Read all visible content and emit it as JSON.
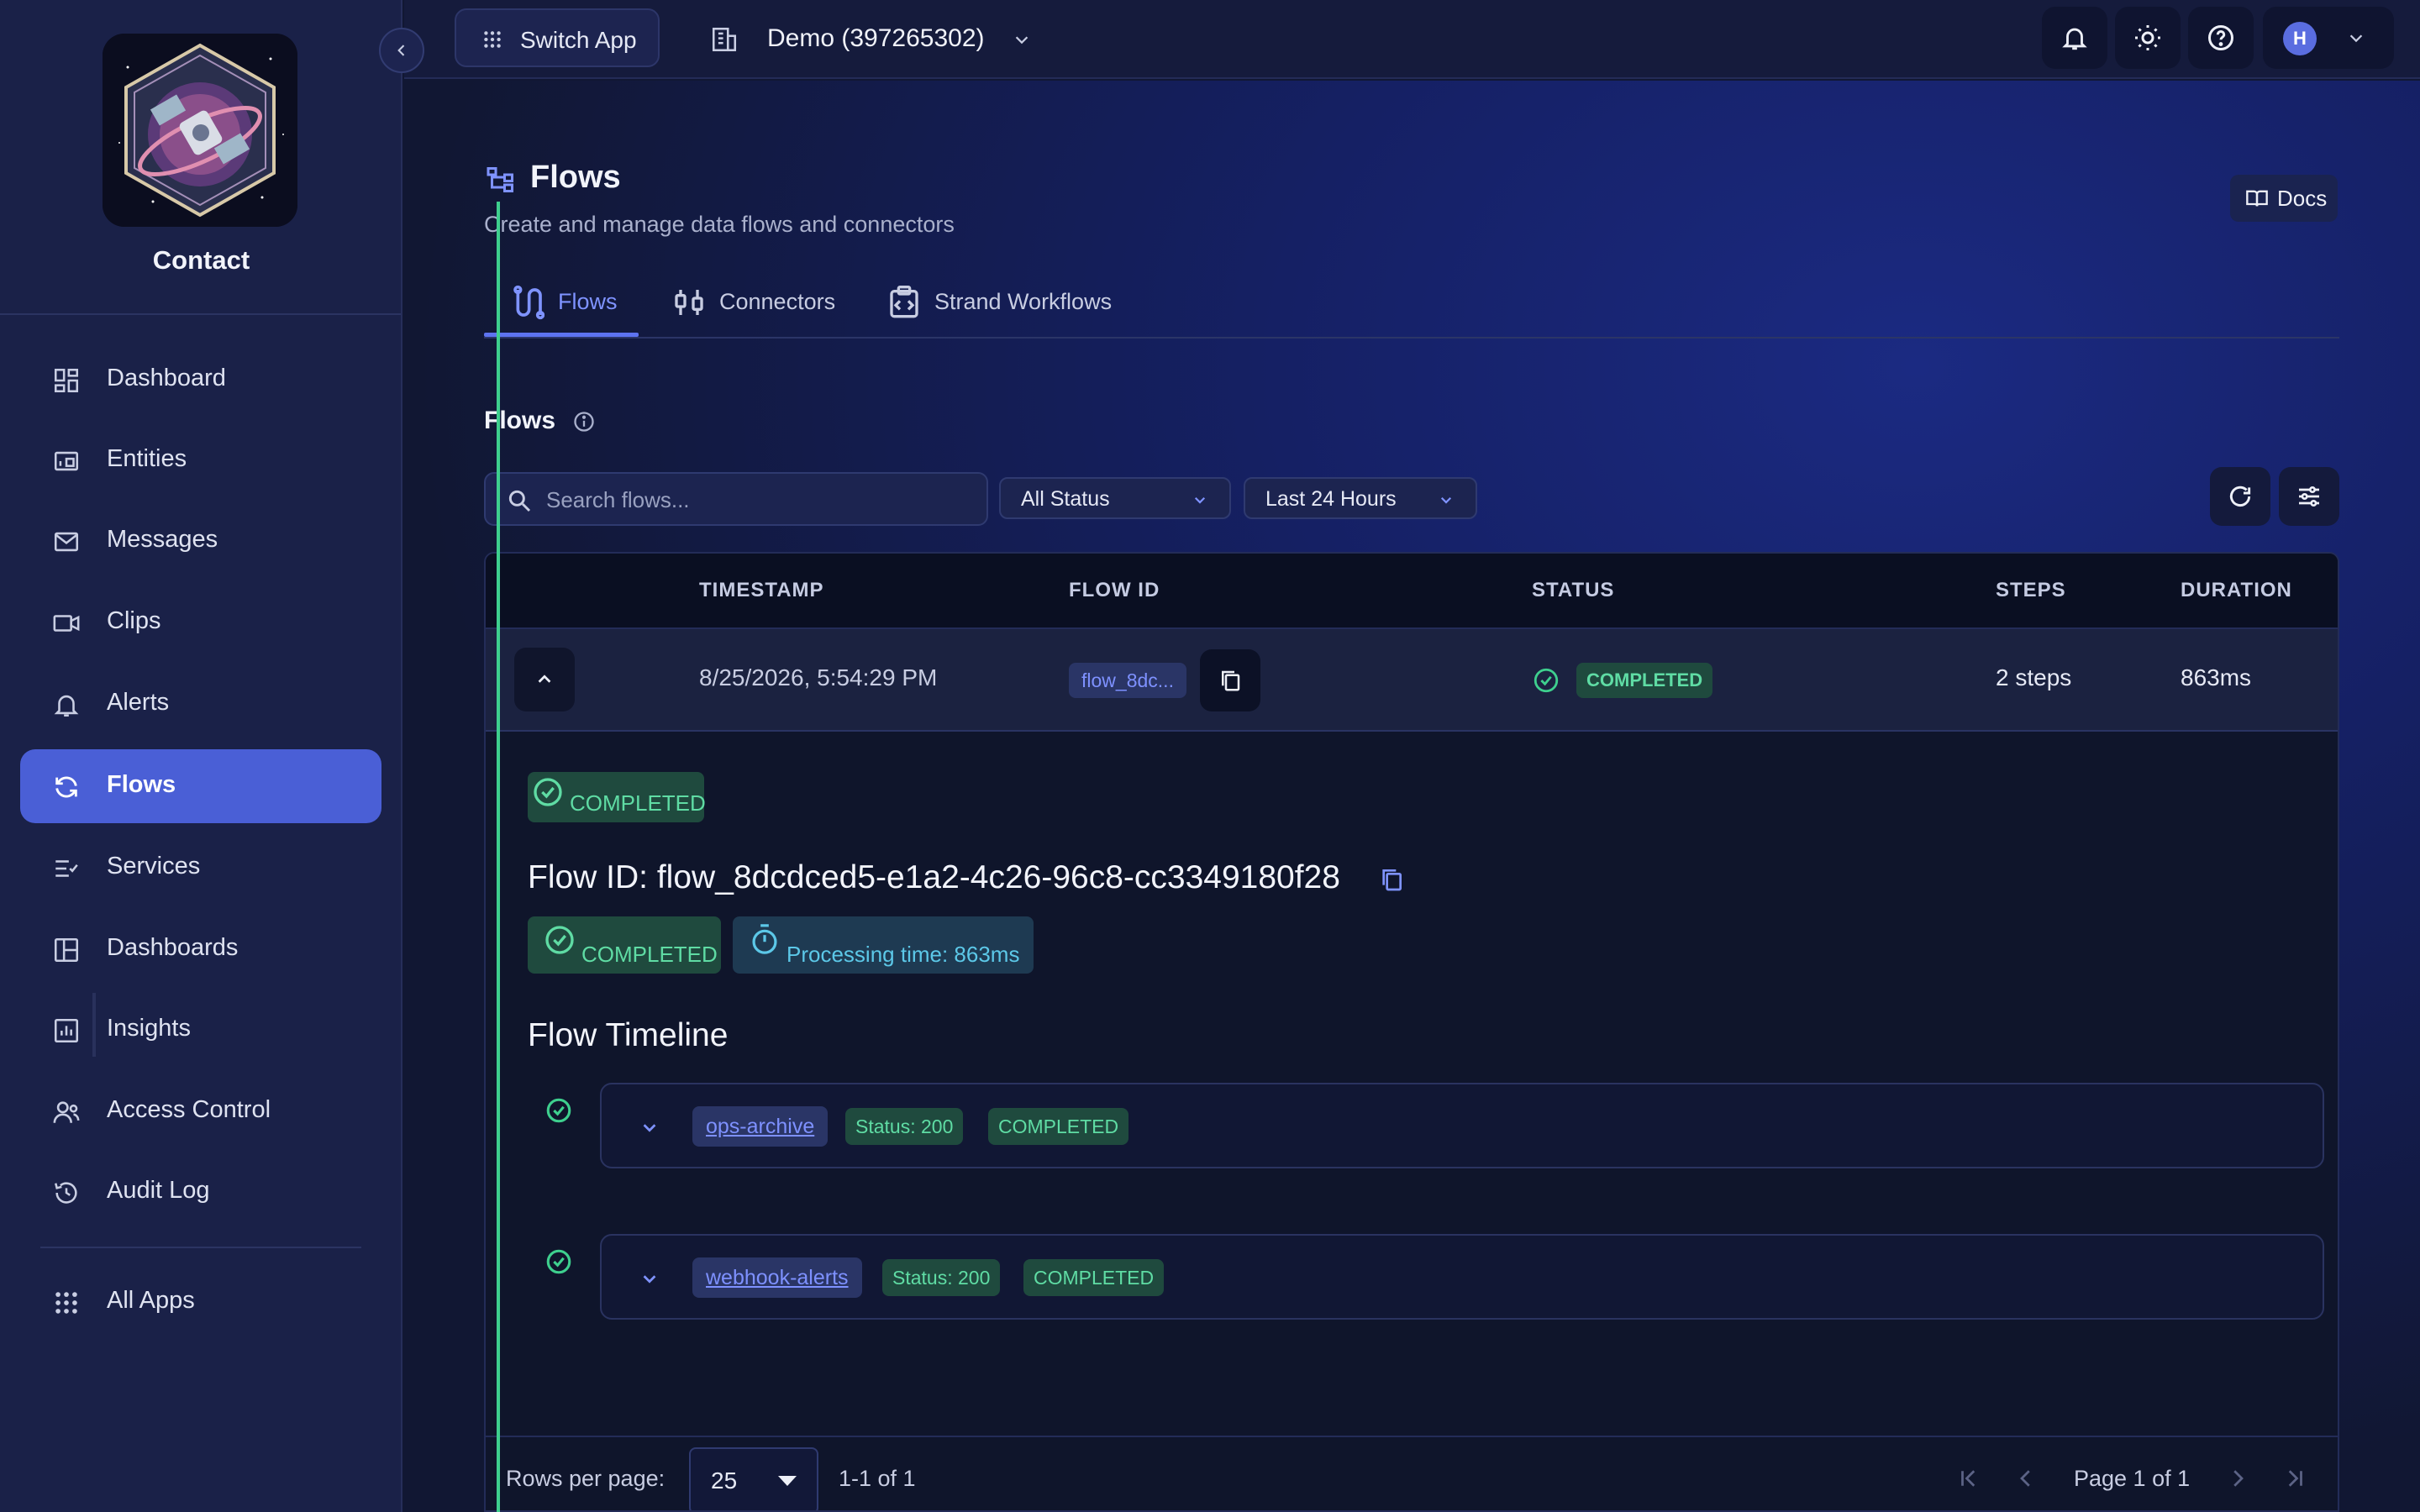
{
  "sidebar": {
    "app_name": "Contact",
    "nav": [
      {
        "label": "Dashboard",
        "icon": "dashboard-icon"
      },
      {
        "label": "Entities",
        "icon": "entities-icon"
      },
      {
        "label": "Messages",
        "icon": "mail-icon"
      },
      {
        "label": "Clips",
        "icon": "video-icon"
      },
      {
        "label": "Alerts",
        "icon": "bell-icon"
      },
      {
        "label": "Flows",
        "icon": "sync-icon",
        "active": true
      },
      {
        "label": "Services",
        "icon": "checklist-icon"
      },
      {
        "label": "Dashboards",
        "icon": "layout-icon"
      },
      {
        "label": "Insights",
        "icon": "chart-icon"
      },
      {
        "label": "Access Control",
        "icon": "users-icon"
      },
      {
        "label": "Audit Log",
        "icon": "history-icon"
      }
    ],
    "all_apps": "All Apps"
  },
  "topbar": {
    "switch_app": "Switch App",
    "org": "Demo (397265302)",
    "avatar_initial": "H"
  },
  "page": {
    "title": "Flows",
    "subtitle": "Create and manage data flows and connectors",
    "docs": "Docs",
    "tabs": [
      "Flows",
      "Connectors",
      "Strand Workflows"
    ]
  },
  "section": {
    "title": "Flows"
  },
  "filters": {
    "search_placeholder": "Search flows...",
    "status": "All Status",
    "range": "Last 24 Hours"
  },
  "table": {
    "columns": [
      "TIMESTAMP",
      "FLOW ID",
      "STATUS",
      "STEPS",
      "DURATION"
    ],
    "rows": [
      {
        "timestamp": "8/25/2026, 5:54:29 PM",
        "flow_id": "flow_8dc...",
        "status": "COMPLETED",
        "steps": "2 steps",
        "duration": "863ms"
      }
    ]
  },
  "detail": {
    "status": "COMPLETED",
    "flow_id_line": "Flow ID: flow_8dcdced5-e1a2-4c26-96c8-cc3349180f28",
    "status2": "COMPLETED",
    "processing": "Processing time: 863ms",
    "timeline_title": "Flow Timeline",
    "timeline": [
      {
        "service": "ops-archive",
        "code": "Status: 200",
        "state": "COMPLETED"
      },
      {
        "service": "webhook-alerts",
        "code": "Status: 200",
        "state": "COMPLETED"
      }
    ]
  },
  "footer": {
    "rows_per_page_label": "Rows per page:",
    "rows_per_page": "25",
    "range": "1-1 of 1",
    "page": "Page 1 of 1"
  },
  "colors": {
    "accent": "#4a5fd6",
    "success": "#3ecf8e",
    "sidebar": "#1a2148",
    "background": "#111733"
  }
}
